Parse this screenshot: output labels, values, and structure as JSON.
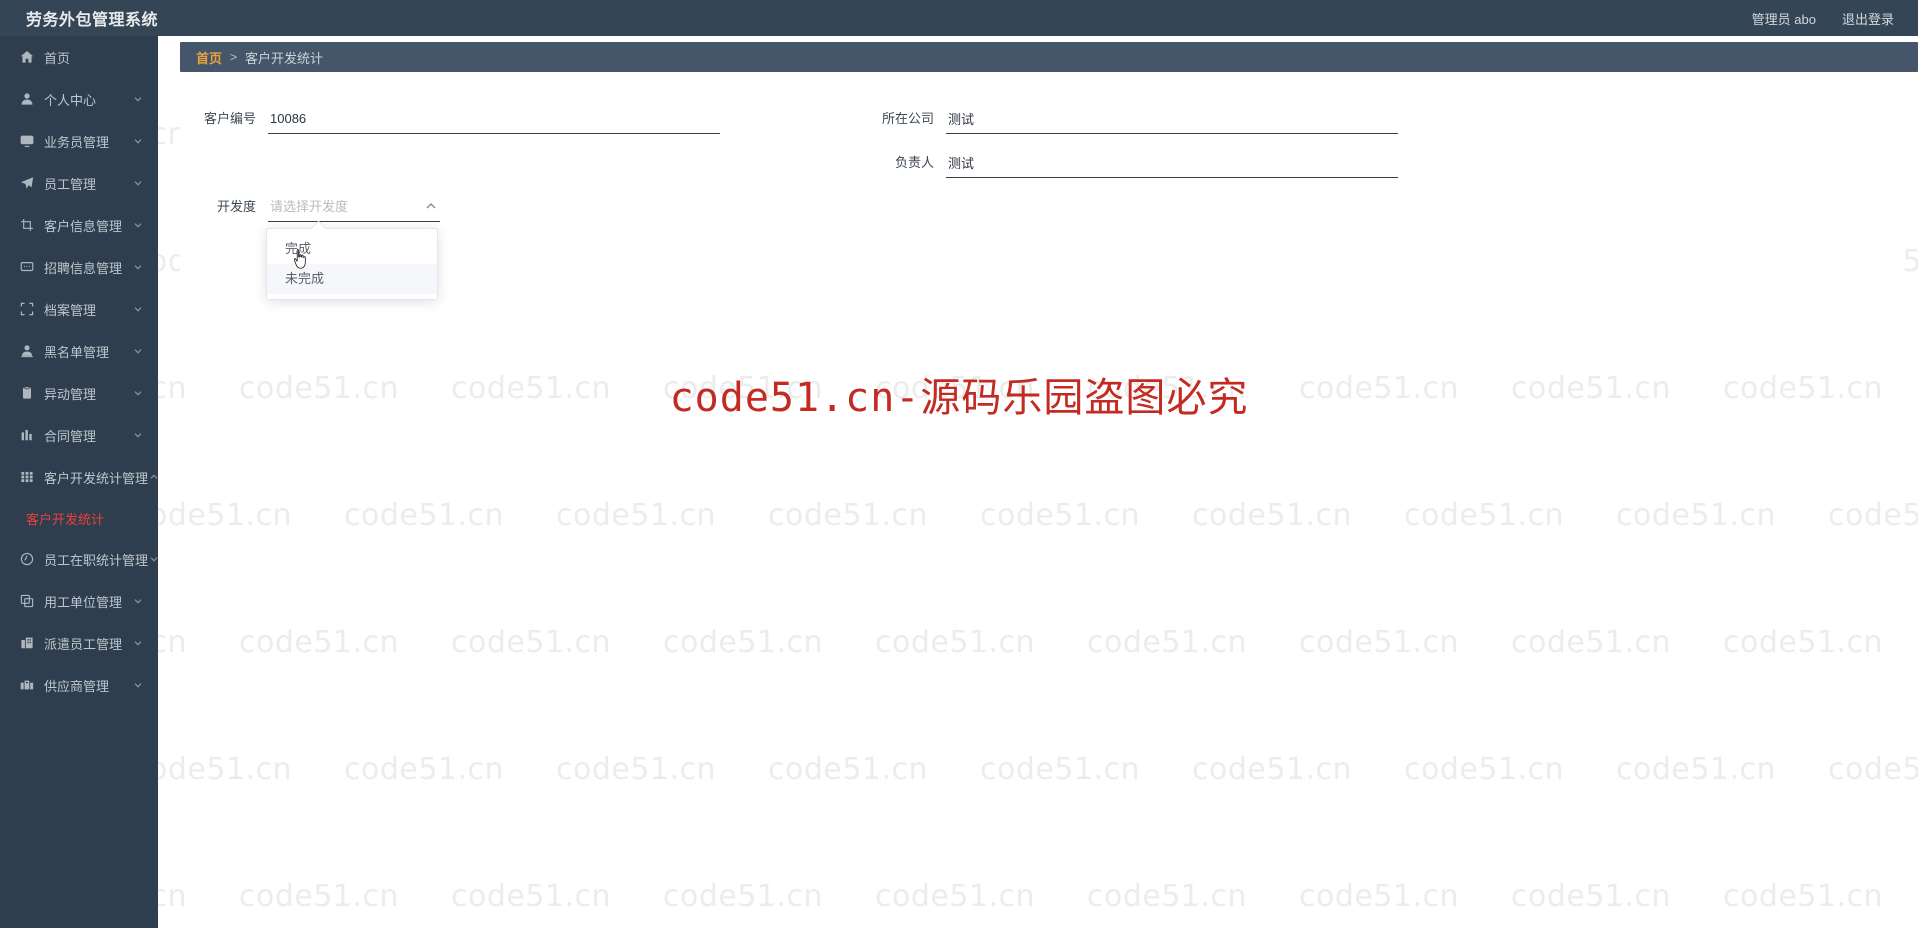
{
  "app": {
    "brand": "劳务外包管理系统",
    "user": "管理员 abo",
    "logout": "退出登录"
  },
  "breadcrumb": {
    "home": "首页",
    "separator": ">",
    "current": "客户开发统计"
  },
  "sidebar": {
    "items": [
      {
        "label": "首页",
        "icon": "home-icon",
        "expandable": false
      },
      {
        "label": "个人中心",
        "icon": "user-icon",
        "expandable": true
      },
      {
        "label": "业务员管理",
        "icon": "monitor-icon",
        "expandable": true
      },
      {
        "label": "员工管理",
        "icon": "send-icon",
        "expandable": true
      },
      {
        "label": "客户信息管理",
        "icon": "crop-icon",
        "expandable": true
      },
      {
        "label": "招聘信息管理",
        "icon": "chat-icon",
        "expandable": true
      },
      {
        "label": "档案管理",
        "icon": "scan-icon",
        "expandable": true
      },
      {
        "label": "黑名单管理",
        "icon": "person-icon",
        "expandable": true
      },
      {
        "label": "异动管理",
        "icon": "document-icon",
        "expandable": true
      },
      {
        "label": "合同管理",
        "icon": "bar-chart-icon",
        "expandable": true
      },
      {
        "label": "客户开发统计管理",
        "icon": "grid-icon",
        "expandable": true,
        "open": true
      },
      {
        "label": "员工在职统计管理",
        "icon": "clock-icon",
        "expandable": true
      },
      {
        "label": "用工单位管理",
        "icon": "copy-icon",
        "expandable": true
      },
      {
        "label": "派遣员工管理",
        "icon": "office-icon",
        "expandable": true
      },
      {
        "label": "供应商管理",
        "icon": "supplier-icon",
        "expandable": true
      }
    ],
    "active_submenu": "客户开发统计"
  },
  "form": {
    "customer_no": {
      "label": "客户编号",
      "value": "10086",
      "placeholder": ""
    },
    "company": {
      "label": "所在公司",
      "value": "测试",
      "placeholder": ""
    },
    "owner": {
      "label": "负责人",
      "value": "测试",
      "placeholder": ""
    },
    "development": {
      "label": "开发度",
      "placeholder": "请选择开发度",
      "value": "",
      "options": [
        "完成",
        "未完成"
      ],
      "hovered_option": "未完成"
    }
  },
  "watermark": {
    "tile_text": "code51.cn",
    "red_text": "code51.cn-源码乐园盗图必究",
    "red_color": "#c22a22"
  },
  "theme": {
    "sidebar_bg": "#2f3e4e",
    "header_bg": "#344555",
    "breadcrumb_bg": "#46566a",
    "accent": "#e6a23c",
    "active_submenu_color": "#e8413a"
  }
}
